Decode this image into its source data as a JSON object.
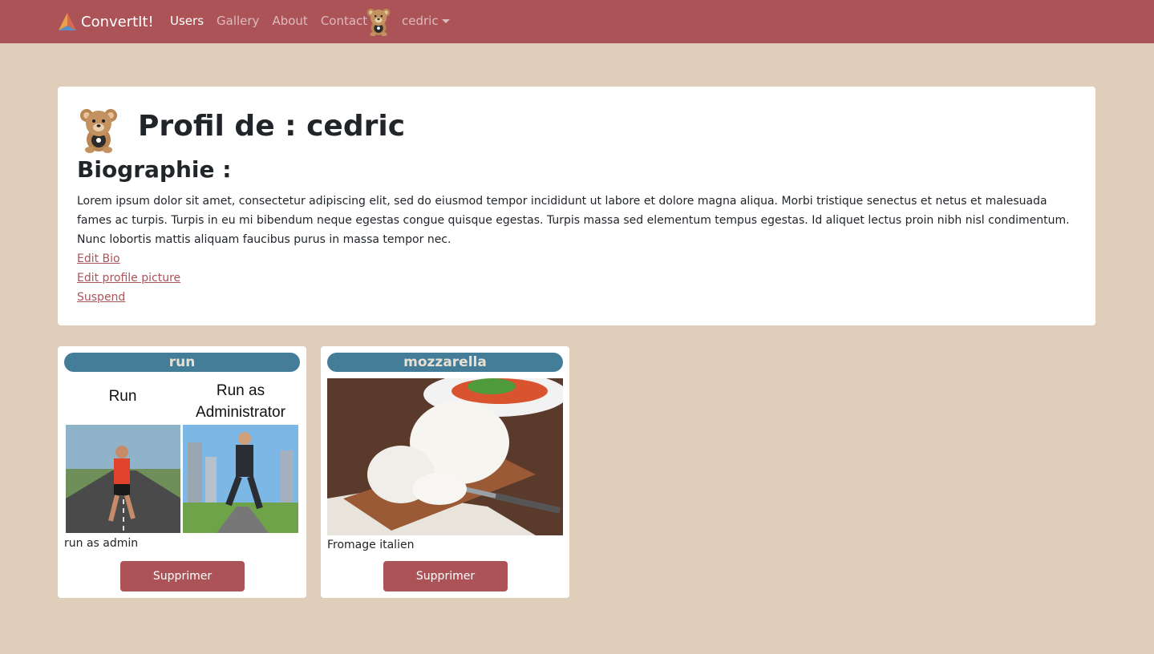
{
  "navbar": {
    "brand": "ConvertIt!",
    "links": [
      "Users",
      "Gallery",
      "About",
      "Contact"
    ],
    "user": "cedric",
    "icons": {
      "brand": "brand-logo-icon",
      "avatar": "teddy-bear-avatar"
    }
  },
  "profile": {
    "title": "Profil de : cedric",
    "bio_heading": "Biographie :",
    "bio_text": "Lorem ipsum dolor sit amet, consectetur adipiscing elit, sed do eiusmod tempor incididunt ut labore et dolore magna aliqua. Morbi tristique senectus et netus et malesuada fames ac turpis. Turpis in eu mi bibendum neque egestas congue quisque egestas. Turpis massa sed elementum tempus egestas. Id aliquet lectus proin nibh nisl condimentum. Nunc lobortis mattis aliquam faucibus purus in massa tempor nec.",
    "links": [
      "Edit Bio",
      "Edit profile picture",
      "Suspend"
    ]
  },
  "gallery": [
    {
      "title": "run",
      "image_labels": [
        "Run",
        "Run as Administrator"
      ],
      "description": "run as admin",
      "button": "Supprimer"
    },
    {
      "title": "mozzarella",
      "description": "Fromage italien",
      "button": "Supprimer"
    }
  ],
  "colors": {
    "navbar": "#ab5357",
    "page_background": "#dfceba",
    "pill": "#437d98",
    "button": "#ab5357"
  }
}
